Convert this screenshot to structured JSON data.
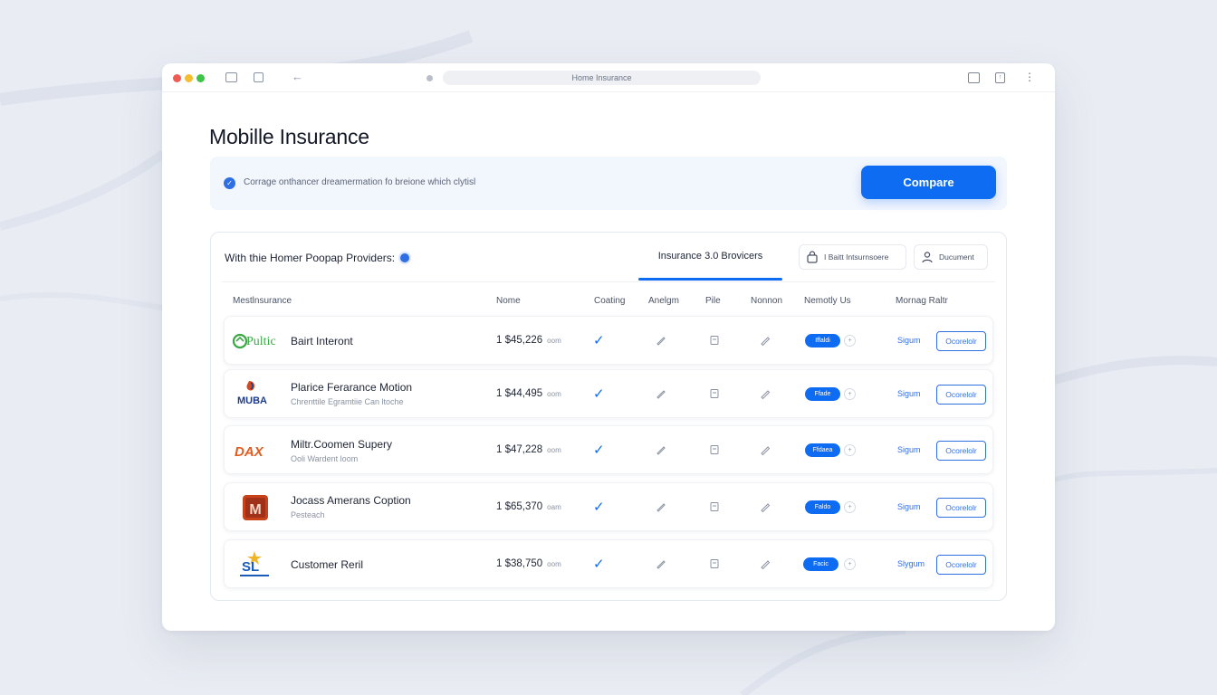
{
  "browser": {
    "address": "Home Insurance"
  },
  "page": {
    "title": "Mobille Insurance"
  },
  "banner": {
    "text": "Corrage onthancer dreamermation fo breione which clytisl",
    "compare_label": "Compare"
  },
  "panel": {
    "title": "With thie Homer Poopap Providers:",
    "active_tab": "Insurance 3.0 Brovicers",
    "chip_insurance": "I Baitt Intsurnsoere",
    "chip_document": "Ducument"
  },
  "columns": {
    "insurance": "Mestlnsurance",
    "name": "Nome",
    "coating": "Coating",
    "analysis": "Anelgm",
    "pile": "Pile",
    "nonnon": "Nonnon",
    "nemotly": "Nemotly Us",
    "manage": "Mornag Raltr"
  },
  "rows": [
    {
      "logo_text": "Pultic",
      "name": "Bairt Interont",
      "subtitle": "",
      "price": "1 $45,226",
      "unit": "oom",
      "toggle": "Iffaldi",
      "signup": "Sigum",
      "action": "Ocorelolr",
      "logo_color": "#3aa845"
    },
    {
      "logo_text": "MUBA",
      "name": "Plarice Ferarance Motion",
      "subtitle": "Chrenttile Egramtiie Can ltoche",
      "price": "1 $44,495",
      "unit": "oom",
      "toggle": "Ffade",
      "signup": "Sigum",
      "action": "Ocorelolr",
      "logo_color": "#1e3c8c"
    },
    {
      "logo_text": "DAX",
      "name": "Miltr.Coomen Supery",
      "subtitle": "Ooli Wardent loom",
      "price": "1 $47,228",
      "unit": "oom",
      "toggle": "Ffdaea",
      "signup": "Sigum",
      "action": "Ocorelolr",
      "logo_color": "#e35a1e"
    },
    {
      "logo_text": "M",
      "name": "Jocass Amerans Coption",
      "subtitle": "Pesteach",
      "price": "1 $65,370",
      "unit": "oam",
      "toggle": "Faldo",
      "signup": "Sigum",
      "action": "Ocorelolr",
      "logo_color": "#c8431a"
    },
    {
      "logo_text": "SL",
      "name": "Customer Reril",
      "subtitle": "",
      "price": "1 $38,750",
      "unit": "oom",
      "toggle": "Facic",
      "signup": "Slygum",
      "action": "Ocorelolr",
      "logo_color": "#1a5bb8"
    }
  ]
}
